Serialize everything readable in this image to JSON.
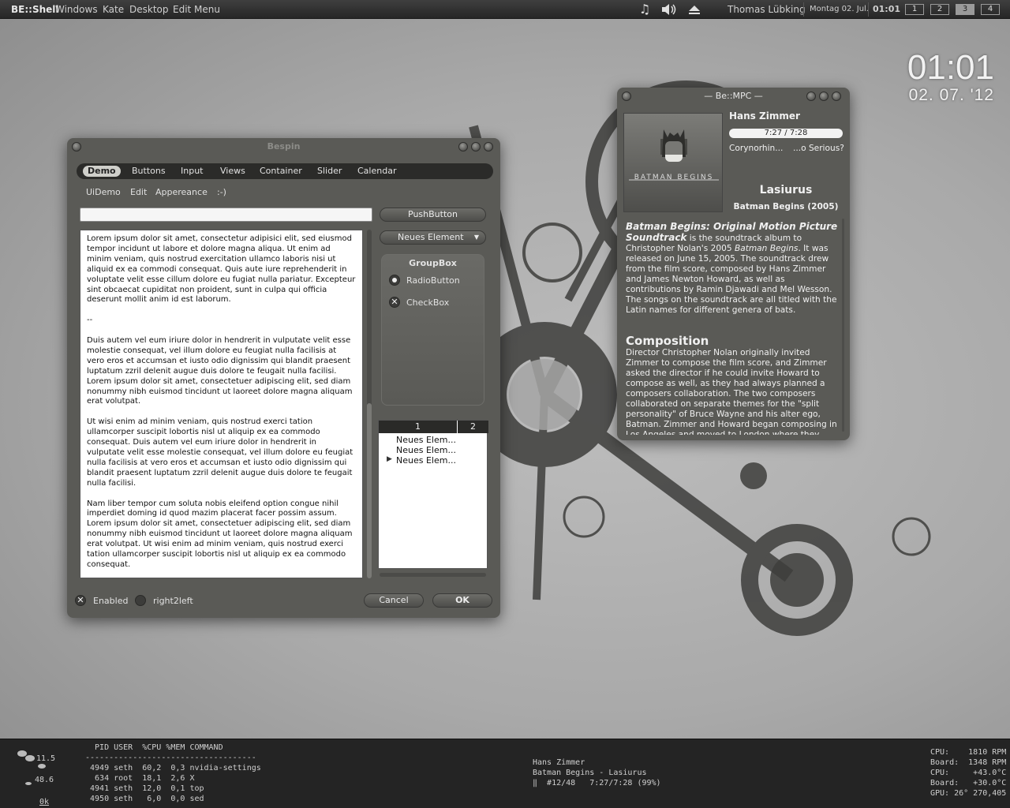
{
  "top_panel": {
    "brand": "BE::Shell",
    "menus": [
      "Windows",
      "Kate",
      "Desktop",
      "Edit Menu"
    ],
    "user": "Thomas Lübking",
    "date": "Montag 02. Jul.",
    "time": "01:01",
    "tray_icons": [
      "music-note-icon",
      "volume-icon",
      "eject-icon"
    ],
    "desktops": [
      "1",
      "2",
      "3",
      "4"
    ],
    "active_desktop": 3
  },
  "desktop_clock": {
    "time": "01:01",
    "date": "02. 07. '12"
  },
  "bespin": {
    "title": "Bespin",
    "tabs": [
      "Demo",
      "Buttons",
      "Input",
      "Views",
      "Container",
      "Slider",
      "Calendar"
    ],
    "active_tab": "Demo",
    "menubar": [
      "UiDemo",
      "Edit",
      "Appereance",
      ":-)"
    ],
    "lineedit_value": "",
    "push_button": "PushButton",
    "combo_value": "Neues Element",
    "groupbox": {
      "title": "GroupBox",
      "radio": "RadioButton",
      "check": "CheckBox"
    },
    "text_paragraphs": [
      "Lorem ipsum dolor sit amet, consectetur adipisici elit, sed eiusmod tempor incidunt ut labore et dolore magna aliqua. Ut enim ad minim veniam, quis nostrud exercitation ullamco laboris nisi ut aliquid ex ea commodi consequat. Quis aute iure reprehenderit in voluptate velit esse cillum dolore eu fugiat nulla pariatur. Excepteur sint obcaecat cupiditat non proident, sunt in culpa qui officia deserunt mollit anim id est laborum.",
      "--",
      "Duis autem vel eum iriure dolor in hendrerit in vulputate velit esse molestie consequat, vel illum dolore eu feugiat nulla facilisis at vero eros et accumsan et iusto odio dignissim qui blandit praesent luptatum zzril delenit augue duis dolore te feugait nulla facilisi. Lorem ipsum dolor sit amet, consectetuer adipiscing elit, sed diam nonummy nibh euismod tincidunt ut laoreet dolore magna aliquam erat volutpat.",
      "Ut wisi enim ad minim veniam, quis nostrud exerci tation ullamcorper suscipit lobortis nisl ut aliquip ex ea commodo consequat. Duis autem vel eum iriure dolor in hendrerit in vulputate velit esse molestie consequat, vel illum dolore eu feugiat nulla facilisis at vero eros et accumsan et iusto odio dignissim qui blandit praesent luptatum zzril delenit augue duis dolore te feugait nulla facilisi.",
      "Nam liber tempor cum soluta nobis eleifend option congue nihil imperdiet doming id quod mazim placerat facer possim assum. Lorem ipsum dolor sit amet, consectetuer adipiscing elit, sed diam nonummy nibh euismod tincidunt ut laoreet dolore magna aliquam erat volutpat. Ut wisi enim ad minim veniam, quis nostrud exerci tation ullamcorper suscipit lobortis nisl ut aliquip ex ea commodo consequat."
    ],
    "tree_headers": [
      "1",
      "2"
    ],
    "tree_rows": [
      "Neues Elem...",
      "Neues Elem...",
      "Neues Elem..."
    ],
    "enabled_label": "Enabled",
    "rtl_label": "right2left",
    "cancel": "Cancel",
    "ok": "OK"
  },
  "mpc": {
    "title": "Be::MPC",
    "artist": "Hans Zimmer",
    "progress": "7:27 / 7:28",
    "progress_fraction": 0.99,
    "prev_track": "Corynorhin...",
    "next_track": "...o Serious?",
    "cover_text": "BATMAN BEGINS",
    "track": "Lasiurus",
    "album": "Batman Begins (2005)",
    "wiki_title": "Batman Begins: Original Motion Picture Soundtrack",
    "wiki_p1_a": " is the soundtrack album to Christopher Nolan's 2005 ",
    "wiki_p1_em": "Batman Begins",
    "wiki_p1_b": ". It was released on June 15, 2005. The soundtrack drew from the film score, composed by Hans Zimmer and James Newton Howard, as well as contributions by Ramin Djawadi and Mel Wesson. The songs on the soundtrack are all titled with the Latin names for different genera of bats.",
    "composition_heading": "Composition",
    "composition_text": "Director Christopher Nolan originally invited Zimmer to compose the film score, and Zimmer asked the director if he could invite Howard to compose as well, as they had always planned a composers collaboration. The two composers collaborated on separate themes for the \"split personality\" of Bruce Wayne and his alter ego, Batman. Zimmer and Howard began composing in Los Angeles and moved to London where they"
  },
  "bottom_panel": {
    "load_values": [
      "11.5",
      "48.6",
      "0k"
    ],
    "top_header": "  PID USER  %CPU %MEM COMMAND",
    "top_separator": "------------------------------------",
    "top_rows": [
      " 4949 seth  60,2  0,3 nvidia-settings",
      "  634 root  18,1  2,6 X",
      " 4941 seth  12,0  0,1 top",
      " 4950 seth   6,0  0,0 sed"
    ],
    "np_lines": [
      "Hans Zimmer",
      "Batman Begins - Lasiurus",
      "‖  #12/48   7:27/7:28 (99%)"
    ],
    "sensors": [
      "CPU:    1810 RPM",
      "Board:  1348 RPM",
      "CPU:     +43.0°C",
      "Board:   +30.0°C",
      "GPU: 26° 270,405"
    ]
  }
}
